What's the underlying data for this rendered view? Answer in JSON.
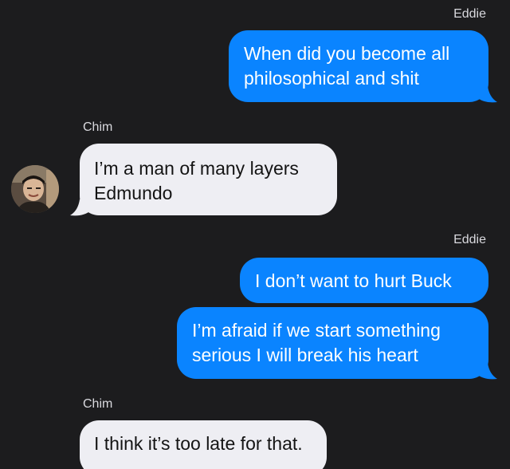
{
  "thread": {
    "groups": [
      {
        "sender": "Eddie",
        "messages": [
          "When did you become all philosophical and shit"
        ]
      },
      {
        "sender": "Chim",
        "avatar_icon": "contact-photo",
        "messages": [
          "I’m a man of many layers Edmundo"
        ]
      },
      {
        "sender": "Eddie",
        "messages": [
          "I don’t want to hurt Buck",
          "I’m afraid if we start something serious I will break his heart"
        ]
      },
      {
        "sender": "Chim",
        "messages": [
          "I think it’s too late for that."
        ]
      }
    ]
  },
  "colors": {
    "background": "#1c1c1e",
    "outgoing_bubble": "#0a84ff",
    "incoming_bubble": "#eeeef3",
    "sender_label": "#d9d9de"
  }
}
